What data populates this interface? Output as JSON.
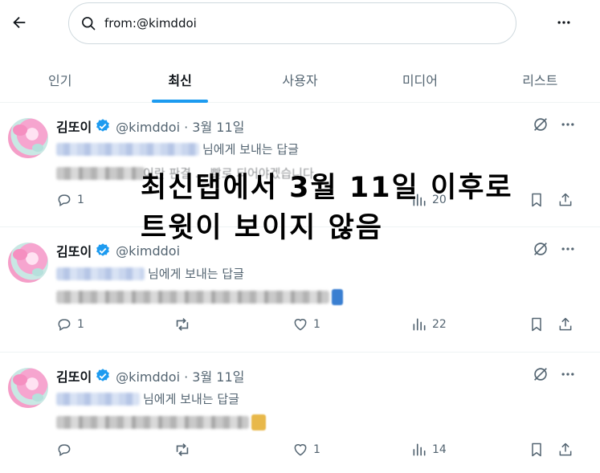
{
  "search": {
    "query": "from:@kimddoi"
  },
  "tabs": [
    {
      "label": "인기"
    },
    {
      "label": "최신"
    },
    {
      "label": "사용자"
    },
    {
      "label": "미디어"
    },
    {
      "label": "리스트"
    }
  ],
  "active_tab": "최신",
  "tweets": [
    {
      "name": "김또이",
      "handle": "@kimddoi · 3월 11일",
      "reply_to": "님에게 보내는 답글",
      "body": "이란 판결 ... 빨로 되어야겠습니다. .",
      "replies": "1",
      "retweets": "",
      "likes": "",
      "views": "20"
    },
    {
      "name": "김또이",
      "handle": "@kimddoi",
      "reply_to": "님에게 보내는 답글",
      "body": "",
      "replies": "1",
      "retweets": "",
      "likes": "1",
      "views": "22"
    },
    {
      "name": "김또이",
      "handle": "@kimddoi · 3월 11일",
      "reply_to": "님에게 보내는 답글",
      "body": "",
      "replies": "",
      "retweets": "",
      "likes": "1",
      "views": "14"
    }
  ],
  "overlay": {
    "line1": "최신탭에서 3월 11일 이후로",
    "line2": "트윗이 보이지 않음"
  },
  "colors": {
    "accent": "#1d9bf0",
    "muted": "#536471",
    "text": "#0f1419"
  },
  "icons": [
    "back-arrow-icon",
    "search-icon",
    "more-icon",
    "verified-badge-icon",
    "grok-icon",
    "reply-icon",
    "retweet-icon",
    "like-icon",
    "views-icon",
    "bookmark-icon",
    "share-icon"
  ]
}
